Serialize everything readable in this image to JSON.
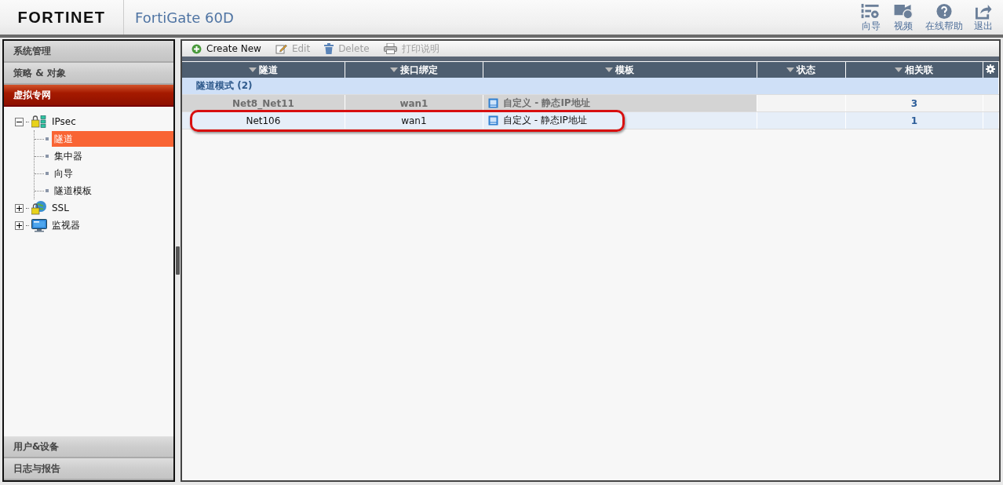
{
  "header": {
    "logo": "FORTINET",
    "title": "FortiGate 60D",
    "tools": [
      {
        "kind": "wizard",
        "label": "向导"
      },
      {
        "kind": "video",
        "label": "视频"
      },
      {
        "kind": "help",
        "label": "在线帮助"
      },
      {
        "kind": "logout",
        "label": "退出"
      }
    ]
  },
  "sidebar": {
    "sections": [
      {
        "label": "系统管理",
        "selected": false
      },
      {
        "label": "策略 & 对象",
        "selected": false
      },
      {
        "label": "虚拟专网",
        "selected": true
      }
    ],
    "tree": [
      {
        "label": "IPsec",
        "kind": "lock",
        "expanded": true,
        "children": [
          {
            "label": "隧道",
            "selected": true
          },
          {
            "label": "集中器",
            "selected": false
          },
          {
            "label": "向导",
            "selected": false
          },
          {
            "label": "隧道模板",
            "selected": false
          }
        ]
      },
      {
        "label": "SSL",
        "kind": "globe",
        "expanded": false
      },
      {
        "label": "监视器",
        "kind": "monitor",
        "expanded": false
      }
    ],
    "bottom_sections": [
      {
        "label": "用户&设备",
        "selected": false
      },
      {
        "label": "日志与报告",
        "selected": false
      }
    ]
  },
  "toolbar": [
    {
      "kind": "add",
      "label": "Create New",
      "disabled": false
    },
    {
      "kind": "edit",
      "label": "Edit",
      "disabled": true
    },
    {
      "kind": "delete",
      "label": "Delete",
      "disabled": true
    },
    {
      "kind": "print",
      "label": "打印说明",
      "disabled": true
    }
  ],
  "table": {
    "columns": [
      "隧道",
      "接口绑定",
      "模板",
      "状态",
      "相关联"
    ],
    "group": "隧道模式 (2)",
    "rows": [
      {
        "cells": [
          "Net8_Net11",
          "wan1",
          "自定义 - 静态IP地址",
          "",
          "3"
        ],
        "dragging": true,
        "outlined": false
      },
      {
        "cells": [
          "Net106",
          "wan1",
          "自定义 - 静态IP地址",
          "",
          "1"
        ],
        "dragging": false,
        "outlined": true
      }
    ]
  }
}
